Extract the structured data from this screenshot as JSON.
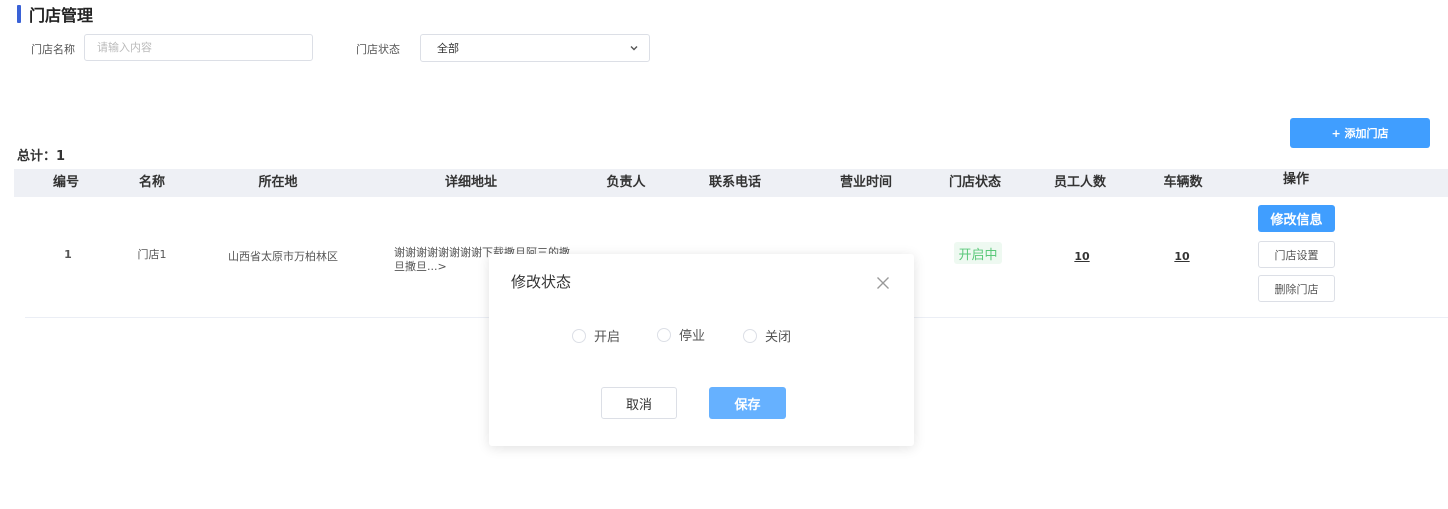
{
  "page": {
    "title": "门店管理"
  },
  "filters": {
    "name_label": "门店名称",
    "name_placeholder": "请输入内容",
    "name_value": "",
    "status_label": "门店状态",
    "status_value": "全部"
  },
  "toolbar": {
    "add_label": "+ 添加门店"
  },
  "summary": {
    "total_text": "总计：1"
  },
  "table": {
    "headers": [
      "编号",
      "名称",
      "所在地",
      "详细地址",
      "负责人",
      "联系电话",
      "营业时间",
      "门店状态",
      "员工人数",
      "车辆数",
      "操作"
    ],
    "rows": [
      {
        "id": "1",
        "name": "门店1",
        "location": "山西省太原市万柏林区",
        "address": "谢谢谢谢谢谢谢谢下载撒旦阿三的撒旦撒旦...>",
        "status": "开启中",
        "staff": "10",
        "vehicles": "10",
        "ops": [
          "修改信息",
          "门店设置",
          "删除门店"
        ]
      }
    ]
  },
  "modal": {
    "title": "修改状态",
    "options": [
      "开启",
      "停业",
      "关闭"
    ],
    "cancel_label": "取消",
    "save_label": "保存"
  },
  "colors": {
    "primary": "#409eff",
    "primary_light": "#66b1ff",
    "accent_bar": "#3a62d7",
    "status_green": "#5bc87a",
    "header_bg": "#eef0f5"
  },
  "icons": {
    "select_arrow": "chevron-down-icon",
    "close": "close-icon"
  }
}
